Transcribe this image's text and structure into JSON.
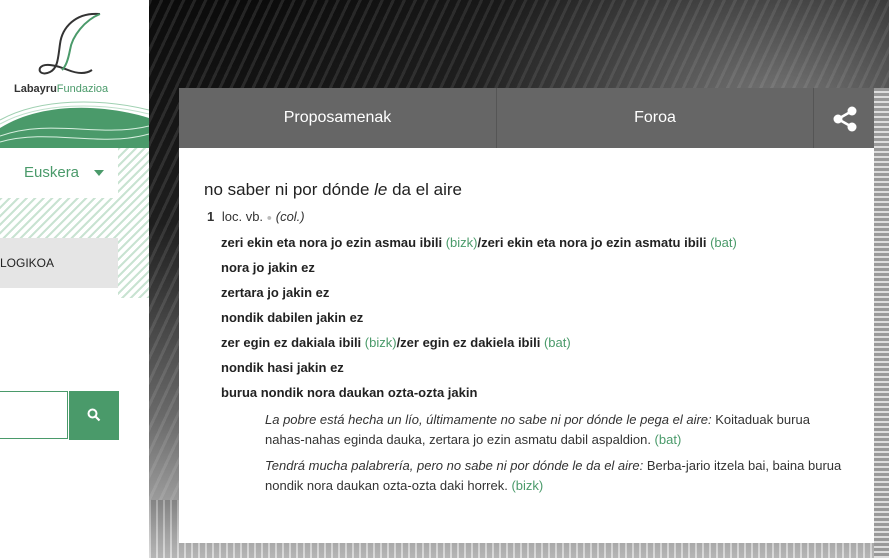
{
  "brand": {
    "name_bold": "Labayru",
    "name_rest": "Fundazioa"
  },
  "language": {
    "selected": "Euskera"
  },
  "nav": {
    "item": "LOGIKOA"
  },
  "tabs": [
    {
      "label": "Proposamenak"
    },
    {
      "label": "Foroa"
    }
  ],
  "entry": {
    "headword_before": "no saber ni por dónde ",
    "headword_pron": "le",
    "headword_after": " da el aire",
    "sense_number": "1",
    "category": "loc. vb.",
    "register": "(col.)",
    "equivalents": [
      {
        "parts": [
          {
            "text": "zeri ekin eta nora jo ezin asmau ibili"
          },
          {
            "text": " (bizk)",
            "tag": true
          },
          {
            "text": "/zeri ekin eta nora jo ezin asmatu ibili"
          },
          {
            "text": " (bat)",
            "tag": true
          }
        ]
      },
      {
        "parts": [
          {
            "text": "nora jo jakin ez"
          }
        ]
      },
      {
        "parts": [
          {
            "text": "zertara jo jakin ez"
          }
        ]
      },
      {
        "parts": [
          {
            "text": "nondik dabilen jakin ez"
          }
        ]
      },
      {
        "parts": [
          {
            "text": "zer egin ez dakiala ibili"
          },
          {
            "text": " (bizk)",
            "tag": true
          },
          {
            "text": "/zer egin ez dakiela ibili"
          },
          {
            "text": " (bat)",
            "tag": true
          }
        ]
      },
      {
        "parts": [
          {
            "text": "nondik hasi jakin ez"
          }
        ]
      },
      {
        "parts": [
          {
            "text": "burua nondik nora daukan ozta-ozta jakin"
          }
        ]
      }
    ],
    "examples": [
      {
        "es": "La pobre está hecha un lío, últimamente no sabe ni por dónde le pega el aire:",
        "eu": " Koitaduak burua nahas-nahas eginda dauka, zertara jo ezin asmatu dabil aspaldion.",
        "tag": " (bat)"
      },
      {
        "es": "Tendrá mucha palabrería, pero no sabe ni por dónde le da el aire:",
        "eu": " Berba-jario itzela bai, baina burua nondik nora daukan ozta-ozta daki horrek.",
        "tag": " (bizk)"
      }
    ]
  },
  "icons": {
    "share": "share-icon",
    "search": "search-icon",
    "caret": "chevron-down-icon",
    "logo": "labayru-logo"
  },
  "colors": {
    "accent": "#4a9a6a",
    "tabs_bg": "#666666",
    "nav_bg": "#e5e5e5"
  }
}
